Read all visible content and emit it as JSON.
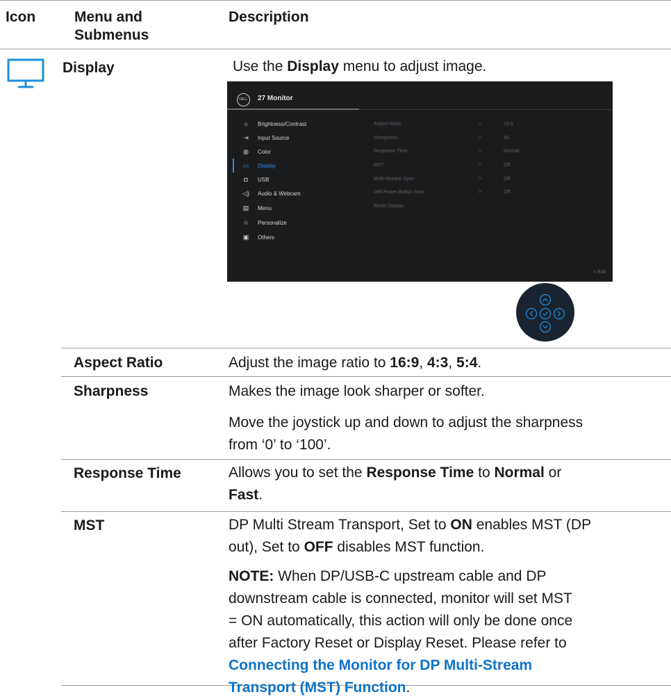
{
  "headers": {
    "icon": "Icon",
    "menu_line1": "Menu and",
    "menu_line2": "Submenus",
    "description": "Description"
  },
  "display": {
    "icon": "monitor-icon",
    "name": "Display",
    "desc_pre": "Use the ",
    "desc_bold": "Display",
    "desc_post": " menu to adjust image."
  },
  "osd": {
    "title": "27 Monitor",
    "logo": "DELL",
    "menu": [
      {
        "label": "Brightness/Contrast",
        "icon": "☼"
      },
      {
        "label": "Input Source",
        "icon": "⇥"
      },
      {
        "label": "Color",
        "icon": "◍"
      },
      {
        "label": "Display",
        "icon": "▭"
      },
      {
        "label": "USB",
        "icon": "◘"
      },
      {
        "label": "Audio & Webcam",
        "icon": "◁)"
      },
      {
        "label": "Menu",
        "icon": "▤"
      },
      {
        "label": "Personalize",
        "icon": "☆"
      },
      {
        "label": "Others",
        "icon": "▣"
      }
    ],
    "submenu": [
      {
        "label": "Aspect Ratio",
        "arrow": ">",
        "value": "16:9"
      },
      {
        "label": "Sharpness",
        "arrow": ">",
        "value": "50"
      },
      {
        "label": "Response Time",
        "arrow": ">",
        "value": "Normal"
      },
      {
        "label": "MST",
        "arrow": ">",
        "value": "Off"
      },
      {
        "label": "Multi-Monitor Sync",
        "arrow": ">",
        "value": "Off"
      },
      {
        "label": "Dell Power Button Sync",
        "arrow": ">",
        "value": "Off"
      },
      {
        "label": "Reset Display",
        "arrow": "",
        "value": ""
      }
    ],
    "exit": "<  Exit"
  },
  "rows": {
    "aspect": {
      "name": "Aspect Ratio",
      "pre": "Adjust the image ratio to ",
      "v1": "16:9",
      "sep1": ", ",
      "v2": "4:3",
      "sep2": ", ",
      "v3": "5:4",
      "end": "."
    },
    "sharpness": {
      "name": "Sharpness",
      "line1": "Makes the image look sharper or softer.",
      "line2a": "Move the joystick up and down to adjust the sharpness",
      "line2b": "from ‘0’ to ‘100’."
    },
    "response": {
      "name": "Response Time",
      "pre": "Allows you to set the ",
      "b1": "Response Time",
      "mid": " to ",
      "b2": "Normal",
      "post": " or",
      "b3": "Fast",
      "end": "."
    },
    "mst": {
      "name": "MST",
      "l1": "DP Multi Stream Transport, Set to ",
      "l1b": "ON",
      "l1c": " enables MST (DP",
      "l2a": "out), Set to ",
      "l2b": "OFF",
      "l2c": " disables MST function.",
      "note_label": "NOTE:",
      "n1": " When DP/USB-C upstream cable and DP",
      "n2": "downstream cable is connected, monitor will set MST",
      "n3": "= ON automatically, this action will only be done once",
      "n4": "after Factory Reset or Display Reset. Please refer to",
      "link1": "Connecting the Monitor for DP Multi-Stream",
      "link2": "Transport (MST) Function",
      "link_end": "."
    }
  }
}
